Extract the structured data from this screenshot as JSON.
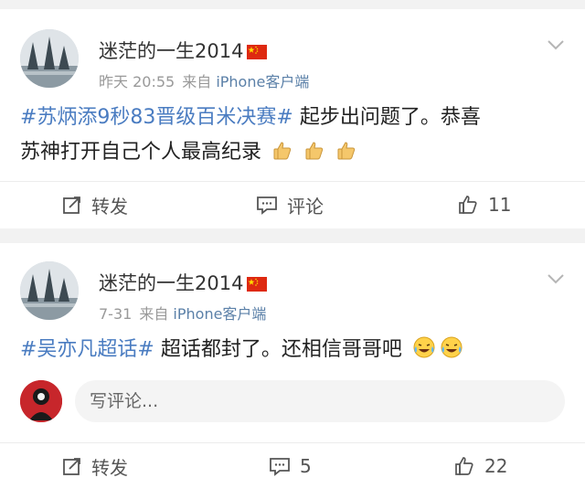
{
  "posts": [
    {
      "username": "迷茫的一生2014",
      "time": "昨天 20:55",
      "source_prefix": "来自",
      "source_device": "iPhone客户端",
      "topic": "#苏炳添9秒83晋级百米决赛#",
      "body_line1": " 起步出问题了。恭喜",
      "body_line2": "苏神打开自己个人最高纪录",
      "emoji": "thumbs-up x3",
      "repost_label": "转发",
      "comment_label": "评论",
      "like_count": "11"
    },
    {
      "username": "迷茫的一生2014",
      "time": "7-31",
      "source_prefix": "来自",
      "source_device": "iPhone客户端",
      "topic": "#吴亦凡超话#",
      "body_line1": " 超话都封了。还相信哥哥吧",
      "emoji": "laughing-crying x2",
      "comment_placeholder": "写评论...",
      "repost_label": "转发",
      "comment_count": "5",
      "like_count": "22"
    }
  ],
  "colors": {
    "topic": "#4a7cc1",
    "meta": "#999999",
    "device": "#5b80a8",
    "flag": "#de2910"
  }
}
